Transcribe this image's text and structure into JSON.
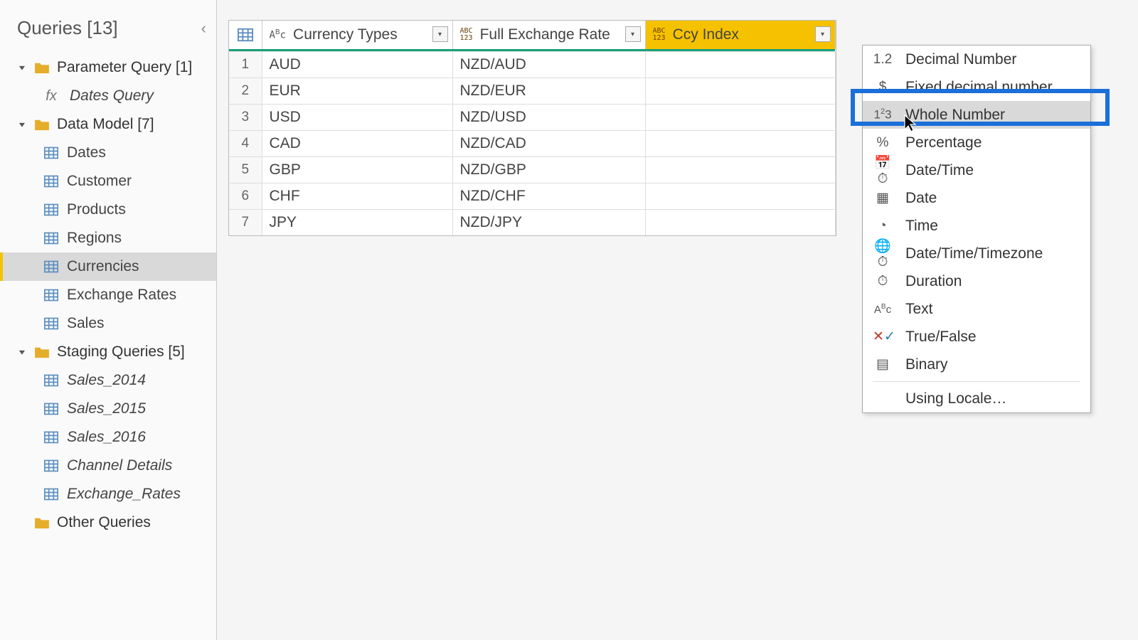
{
  "sidebar": {
    "title": "Queries [13]",
    "groups": [
      {
        "label": "Parameter Query [1]",
        "items": [
          {
            "label": "Dates Query",
            "fx": true
          }
        ]
      },
      {
        "label": "Data Model [7]",
        "items": [
          {
            "label": "Dates"
          },
          {
            "label": "Customer"
          },
          {
            "label": "Products"
          },
          {
            "label": "Regions"
          },
          {
            "label": "Currencies",
            "selected": true
          },
          {
            "label": "Exchange Rates"
          },
          {
            "label": "Sales"
          }
        ]
      },
      {
        "label": "Staging Queries [5]",
        "items": [
          {
            "label": "Sales_2014",
            "italic": true
          },
          {
            "label": "Sales_2015",
            "italic": true
          },
          {
            "label": "Sales_2016",
            "italic": true
          },
          {
            "label": "Channel Details",
            "italic": true
          },
          {
            "label": "Exchange_Rates",
            "italic": true
          }
        ]
      },
      {
        "label": "Other Queries",
        "items": []
      }
    ]
  },
  "table": {
    "columns": [
      {
        "label": "Currency Types",
        "type_icon": "ABc"
      },
      {
        "label": "Full Exchange Rate",
        "type_icon": "ABC123"
      },
      {
        "label": "Ccy Index",
        "type_icon": "ABC123",
        "selected": true
      }
    ],
    "rows": [
      {
        "n": "1",
        "ct": "AUD",
        "fx": "NZD/AUD"
      },
      {
        "n": "2",
        "ct": "EUR",
        "fx": "NZD/EUR"
      },
      {
        "n": "3",
        "ct": "USD",
        "fx": "NZD/USD"
      },
      {
        "n": "4",
        "ct": "CAD",
        "fx": "NZD/CAD"
      },
      {
        "n": "5",
        "ct": "GBP",
        "fx": "NZD/GBP"
      },
      {
        "n": "6",
        "ct": "CHF",
        "fx": "NZD/CHF"
      },
      {
        "n": "7",
        "ct": "JPY",
        "fx": "NZD/JPY"
      }
    ]
  },
  "type_menu": {
    "items": [
      {
        "icon": "1.2",
        "label": "Decimal Number"
      },
      {
        "icon": "$",
        "label": "Fixed decimal number"
      },
      {
        "icon": "1²3",
        "label": "Whole Number",
        "hovered": true
      },
      {
        "icon": "%",
        "label": "Percentage"
      },
      {
        "icon": "📅⏱",
        "label": "Date/Time"
      },
      {
        "icon": "▦",
        "label": "Date"
      },
      {
        "icon": "◔",
        "label": "Time"
      },
      {
        "icon": "🌐⏱",
        "label": "Date/Time/Timezone"
      },
      {
        "icon": "⏱",
        "label": "Duration"
      },
      {
        "icon": "ABc",
        "label": "Text"
      },
      {
        "icon": "✕✓",
        "label": "True/False"
      },
      {
        "icon": "▤",
        "label": "Binary"
      },
      {
        "sep": true
      },
      {
        "icon": "",
        "label": "Using Locale…"
      }
    ]
  }
}
